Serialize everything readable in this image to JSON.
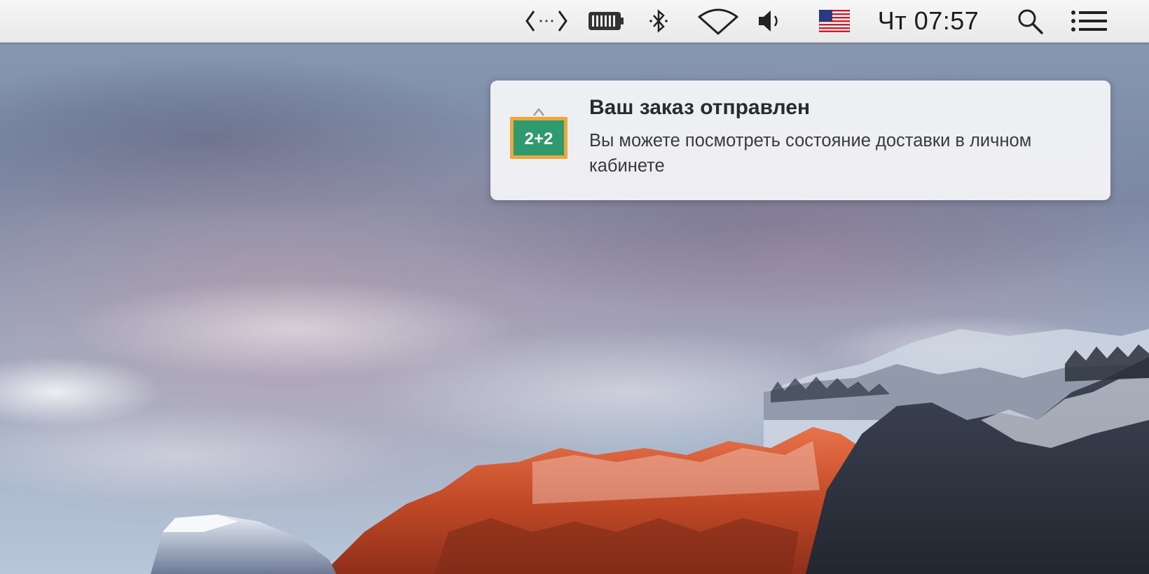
{
  "menubar": {
    "icons": [
      {
        "name": "script-editor-icon"
      },
      {
        "name": "battery-icon"
      },
      {
        "name": "bluetooth-icon"
      },
      {
        "name": "wifi-icon"
      },
      {
        "name": "volume-icon"
      },
      {
        "name": "us-flag-input-icon"
      }
    ],
    "clock": "Чт 07:57",
    "right_icons": [
      {
        "name": "spotlight-search-icon"
      },
      {
        "name": "notification-center-icon"
      }
    ]
  },
  "notification": {
    "app_icon": {
      "name": "app-icon-2plus2",
      "label": "2+2",
      "colors": {
        "board": "#2f9a6f",
        "frame": "#f0a73a"
      }
    },
    "title": "Ваш заказ отправлен",
    "body": "Вы можете посмотреть состояние доставки в личном кабинете"
  },
  "colors": {
    "menubar": "#ededed",
    "notification_bg": "#f2f3f6",
    "cliff_orange": "#d2562c"
  }
}
